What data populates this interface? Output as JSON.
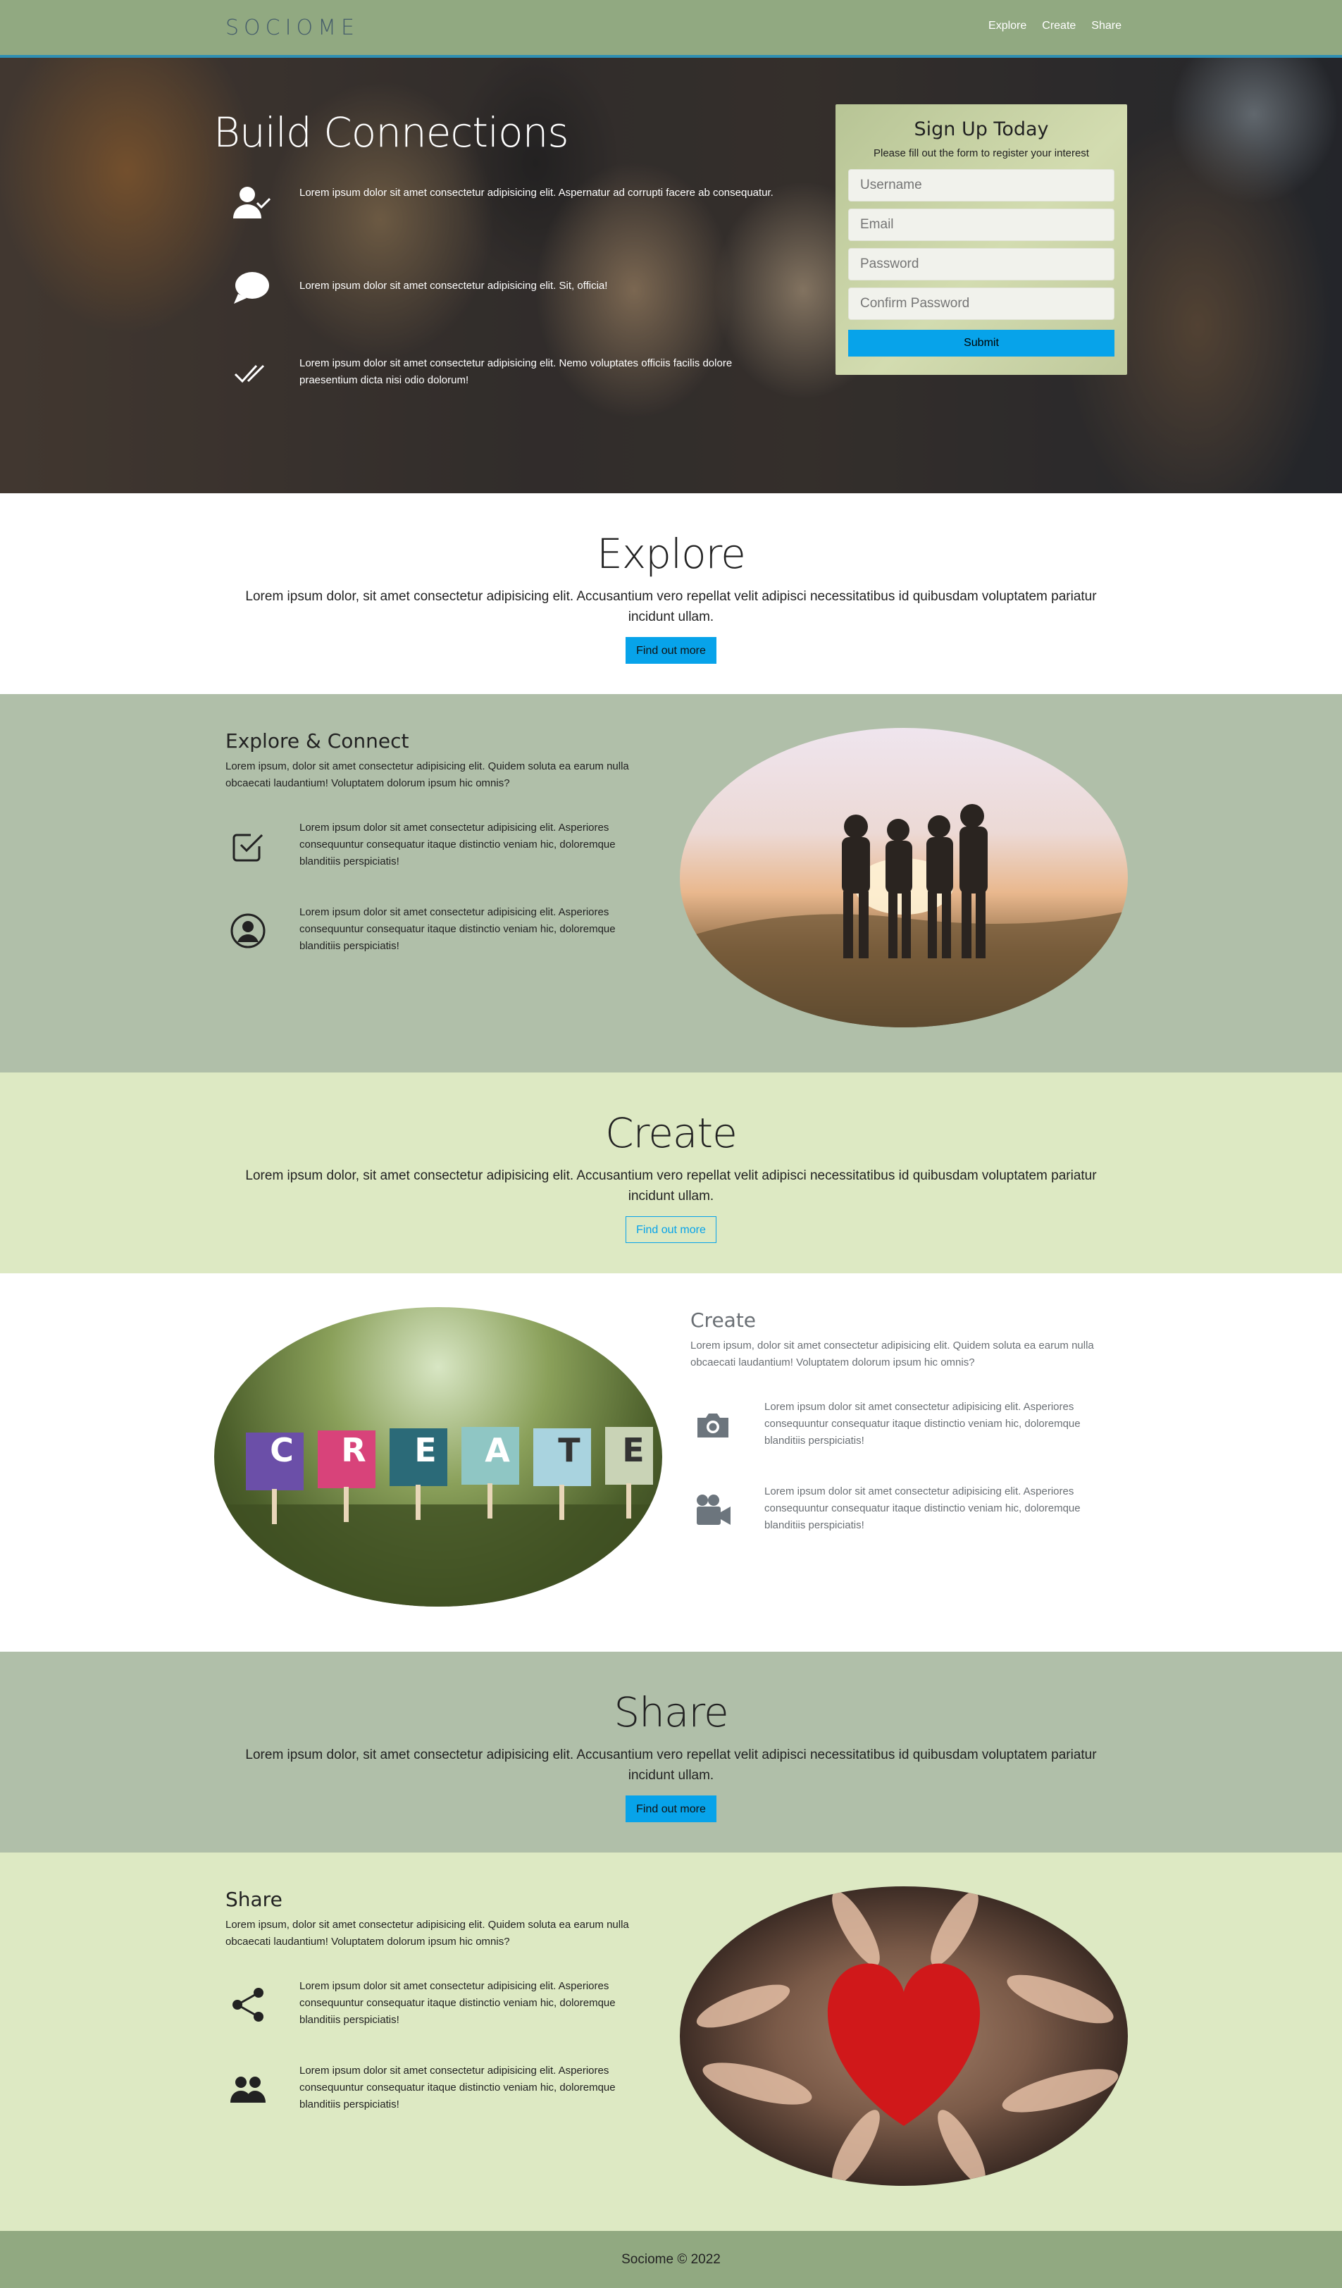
{
  "brand": "SOCIOME",
  "nav": {
    "items": [
      "Explore",
      "Create",
      "Share"
    ]
  },
  "hero": {
    "title": "Build Connections",
    "features": [
      "Lorem ipsum dolor sit amet consectetur adipisicing elit. Aspernatur ad corrupti facere ab consequatur.",
      "Lorem ipsum dolor sit amet consectetur adipisicing elit. Sit, officia!",
      "Lorem ipsum dolor sit amet consectetur adipisicing elit. Nemo voluptates officiis facilis dolore praesentium dicta nisi odio dolorum!"
    ],
    "icons": [
      "user-check-icon",
      "chat-bubble-icon",
      "double-check-icon"
    ]
  },
  "signup": {
    "title": "Sign Up Today",
    "subtitle": "Please fill out the form to register your interest",
    "username_placeholder": "Username",
    "email_placeholder": "Email",
    "password_placeholder": "Password",
    "confirm_placeholder": "Confirm Password",
    "submit": "Submit"
  },
  "explore": {
    "title": "Explore",
    "text": "Lorem ipsum dolor, sit amet consectetur adipisicing elit. Accusantium vero repellat velit adipisci necessitatibus id quibusdam voluptatem pariatur incidunt ullam.",
    "button": "Find out more"
  },
  "explore_detail": {
    "title": "Explore & Connect",
    "lead": "Lorem ipsum, dolor sit amet consectetur adipisicing elit. Quidem soluta ea earum nulla obcaecati laudantium! Voluptatem dolorum ipsum hic omnis?",
    "items": [
      "Lorem ipsum dolor sit amet consectetur adipisicing elit. Asperiores consequuntur consequatur itaque distinctio veniam hic, doloremque blanditiis perspiciatis!",
      "Lorem ipsum dolor sit amet consectetur adipisicing elit. Asperiores consequuntur consequatur itaque distinctio veniam hic, doloremque blanditiis perspiciatis!"
    ]
  },
  "create": {
    "title": "Create",
    "text": "Lorem ipsum dolor, sit amet consectetur adipisicing elit. Accusantium vero repellat velit adipisci necessitatibus id quibusdam voluptatem pariatur incidunt ullam.",
    "button": "Find out more"
  },
  "create_detail": {
    "title": "Create",
    "lead": "Lorem ipsum, dolor sit amet consectetur adipisicing elit. Quidem soluta ea earum nulla obcaecati laudantium! Voluptatem dolorum ipsum hic omnis?",
    "items": [
      "Lorem ipsum dolor sit amet consectetur adipisicing elit. Asperiores consequuntur consequatur itaque distinctio veniam hic, doloremque blanditiis perspiciatis!",
      "Lorem ipsum dolor sit amet consectetur adipisicing elit. Asperiores consequuntur consequatur itaque distinctio veniam hic, doloremque blanditiis perspiciatis!"
    ],
    "letters": [
      "C",
      "R",
      "E",
      "A",
      "T",
      "E"
    ]
  },
  "share": {
    "title": "Share",
    "text": "Lorem ipsum dolor, sit amet consectetur adipisicing elit. Accusantium vero repellat velit adipisci necessitatibus id quibusdam voluptatem pariatur incidunt ullam.",
    "button": "Find out more"
  },
  "share_detail": {
    "title": "Share",
    "lead": "Lorem ipsum, dolor sit amet consectetur adipisicing elit. Quidem soluta ea earum nulla obcaecati laudantium! Voluptatem dolorum ipsum hic omnis?",
    "items": [
      "Lorem ipsum dolor sit amet consectetur adipisicing elit. Asperiores consequuntur consequatur itaque distinctio veniam hic, doloremque blanditiis perspiciatis!",
      "Lorem ipsum dolor sit amet consectetur adipisicing elit. Asperiores consequuntur consequatur itaque distinctio veniam hic, doloremque blanditiis perspiciatis!"
    ]
  },
  "footer": "Sociome © 2022",
  "colors": {
    "nav": "#91a981",
    "accent": "#07a3ea",
    "sage": "#b0bfa9",
    "lime": "#dde9c3",
    "border": "#2e8fb3"
  }
}
